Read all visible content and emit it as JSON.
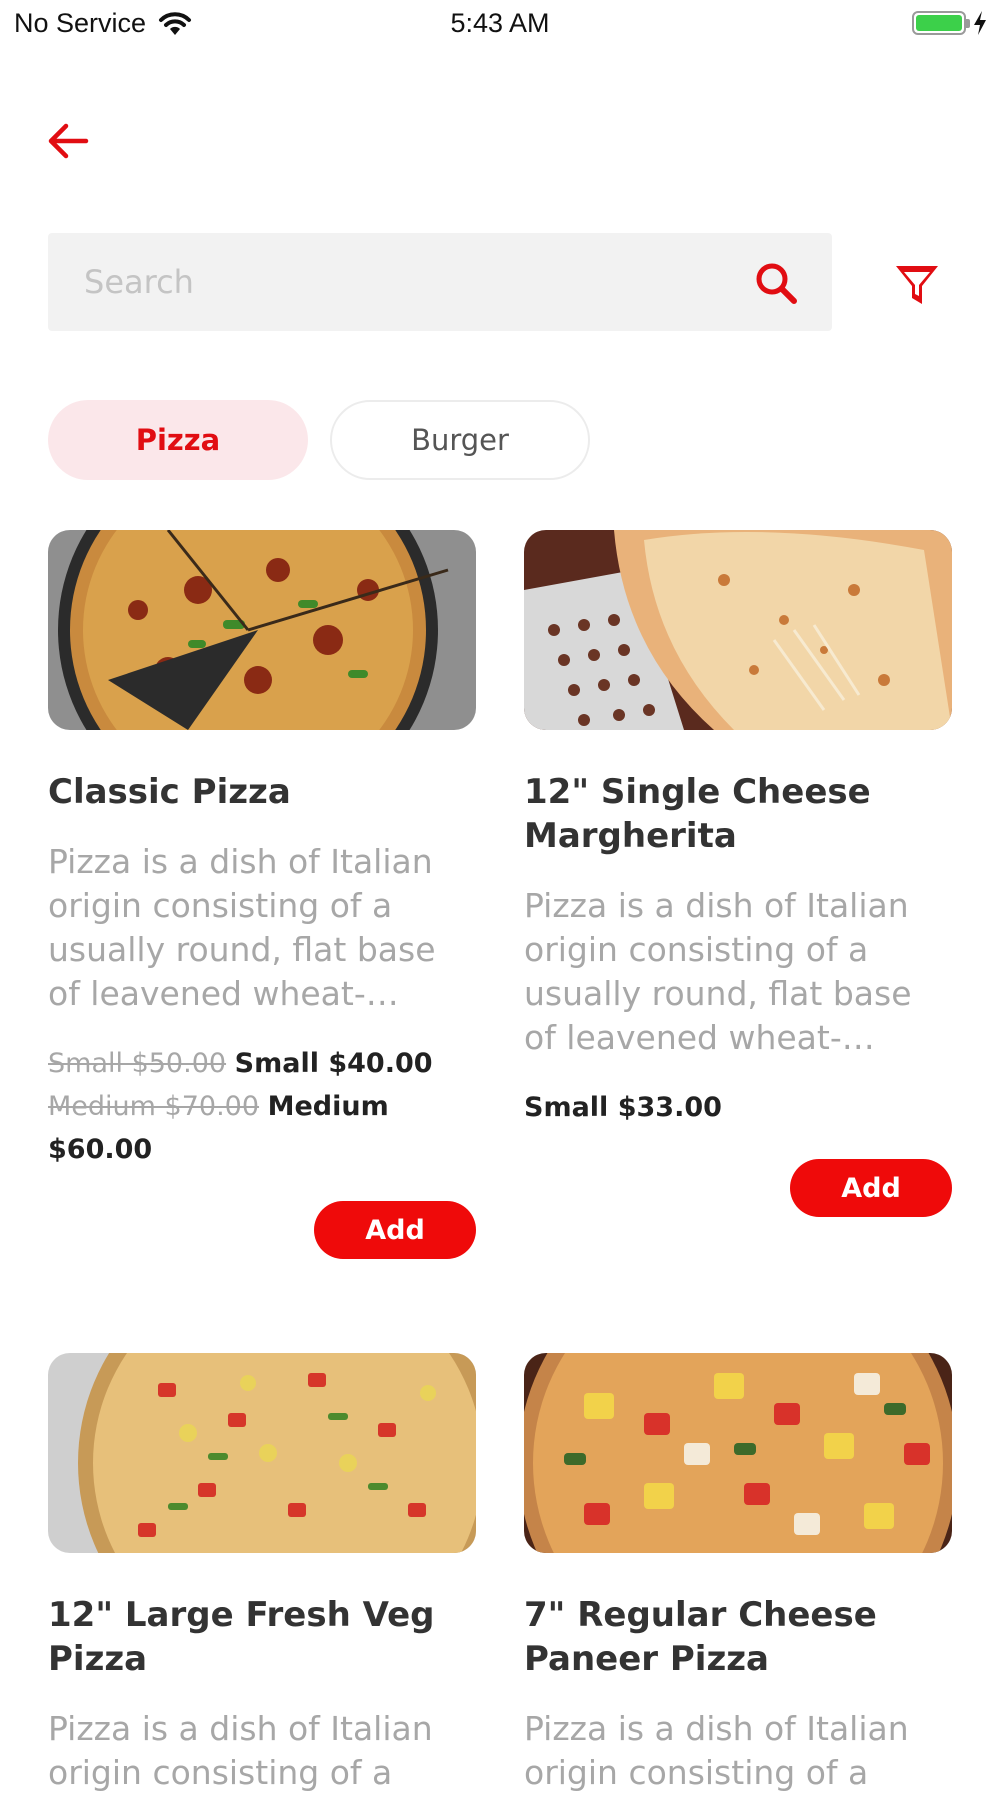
{
  "status_bar": {
    "carrier": "No Service",
    "time": "5:43 AM",
    "battery_level": 1.0
  },
  "colors": {
    "accent": "#e10d12",
    "add_button": "#ef0a0a",
    "active_tab_bg": "#fbe7ea",
    "search_bg": "#f2f2f2"
  },
  "header": {
    "back_icon": "arrow-left-icon"
  },
  "search": {
    "placeholder": "Search",
    "value": "",
    "search_icon": "search-icon",
    "filter_icon": "filter-icon"
  },
  "tabs": [
    {
      "label": "Pizza",
      "active": true
    },
    {
      "label": "Burger",
      "active": false
    }
  ],
  "products": [
    {
      "title": "Classic Pizza",
      "description": "Pizza is a dish of Italian origin consisting of a usually round, flat base of leavened wheat-…",
      "prices": [
        {
          "old": "Small $50.00",
          "new": "Small $40.00"
        },
        {
          "old": "Medium $70.00",
          "new": "Medium $60.00"
        }
      ],
      "add_label": "Add"
    },
    {
      "title": "12\" Single Cheese Margherita",
      "description": "Pizza is a dish of Italian origin consisting of a usually round, flat base of leavened wheat-…",
      "prices": [
        {
          "new": "Small $33.00"
        }
      ],
      "add_label": "Add"
    },
    {
      "title": "12\" Large Fresh Veg Pizza",
      "description": "Pizza is a dish of Italian origin consisting of a"
    },
    {
      "title": "7\" Regular Cheese Paneer Pizza",
      "description": "Pizza is a dish of Italian origin consisting of a"
    }
  ]
}
